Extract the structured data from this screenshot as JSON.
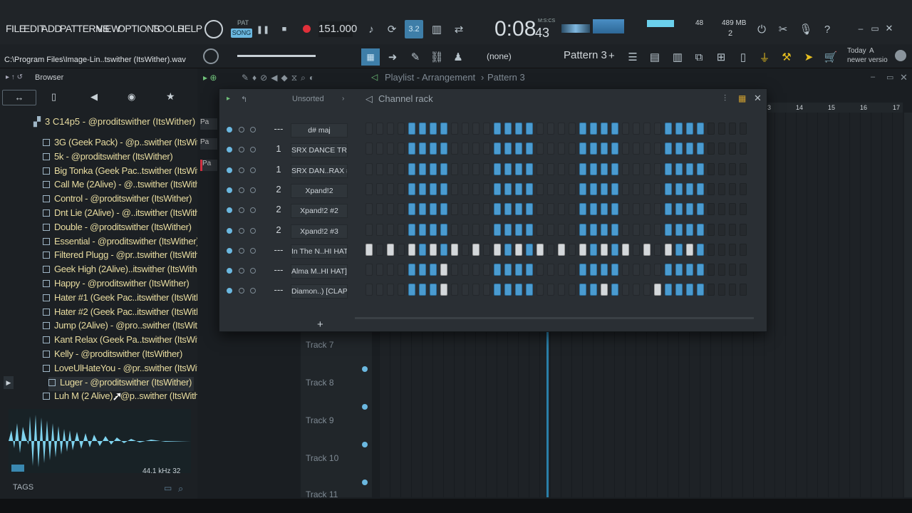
{
  "menu": {
    "items": [
      "FILE",
      "EDIT",
      "ADD",
      "PATTERNS",
      "VIEW",
      "OPTIONS",
      "TOOLS",
      "HELP"
    ]
  },
  "transport": {
    "pat_label": "PAT",
    "song_label": "SONG",
    "tempo": "151.000",
    "time": "0:08",
    "time_sub": "43",
    "time_unit": "M:S:CS"
  },
  "monitor": {
    "cpu_value": "48",
    "memory": "489 MB",
    "polyphony": "2"
  },
  "hint": {
    "date": "Today",
    "message_1": "A",
    "message_2": "newer versio"
  },
  "file_path": "C:\\Program Files\\Image-Lin..tswither (ItsWither).wav",
  "toolbar": {
    "none_label": "(none)",
    "pattern_label": "Pattern 3",
    "plus": "+"
  },
  "browser": {
    "title": "Browser",
    "folder": "3 C14p5 - @proditswither (ItsWither)",
    "items": [
      "3G (Geek Pack) - @p..swither (ItsWither)",
      "5k - @proditswither (ItsWither)",
      "Big Tonka (Geek Pac..tswither (ItsWither)",
      "Call Me (2Alive) - @..tswither (ItsWither)",
      "Control - @proditswither (ItsWither)",
      "Dnt Lie (2Alive) - @..itswither (ItsWither)",
      "Double - @proditswither (ItsWither)",
      "Essential - @proditswither (ItsWither)",
      "Filtered Plugg - @pr..tswither (ItsWither)",
      "Geek High (2Alive)..itswither (ItsWither)",
      "Happy - @proditswither (ItsWither)",
      "Hater #1 (Geek Pac..itswither (ItsWither)",
      "Hater #2 (Geek Pac..itswither (ItsWither)",
      "Jump (2Alive) - @pro..swither (ItsWither)",
      "Kant Relax (Geek Pa..tswither (ItsWither)",
      "Kelly - @proditswither (ItsWither)",
      "LoveUlHateYou - @pr..swither (ItsWither)",
      "Luger - @proditswither (ItsWither)",
      "Luh M (2 Alive) - @p..swither (ItsWither)"
    ],
    "sample_rate": "44.1 kHz 32",
    "tags_label": "TAGS"
  },
  "playlist": {
    "breadcrumb_1": "Playlist - Arrangement",
    "breadcrumb_2": "Pattern 3",
    "ruler": [
      "3",
      "14",
      "15",
      "16",
      "17"
    ],
    "tracks": [
      "Track 7",
      "Track 8",
      "Track 9",
      "Track 10",
      "Track 11"
    ],
    "pattern_tabs": [
      "Pa",
      "Pa",
      "Pa"
    ]
  },
  "channel_rack": {
    "title": "Channel rack",
    "filter": "Unsorted",
    "add_label": "+",
    "channels": [
      {
        "num": "---",
        "name": "d# maj"
      },
      {
        "num": "1",
        "name": "SRX DANCE TRAX"
      },
      {
        "num": "1",
        "name": "SRX DAN..RAX #2"
      },
      {
        "num": "2",
        "name": "Xpand!2"
      },
      {
        "num": "2",
        "name": "Xpand!2 #2"
      },
      {
        "num": "2",
        "name": "Xpand!2 #3"
      },
      {
        "num": "---",
        "name": "In The N..HI HAT]"
      },
      {
        "num": "---",
        "name": "Alma M..HI HAT]"
      },
      {
        "num": "---",
        "name": "Diamon..) [CLAP]"
      }
    ],
    "patterns": [
      "0000111100001111000011110000111100000000000",
      "0000111100001111000011110000111100000000000",
      "0000111100001111000011110000111100000000000",
      "0000111100001111000011110000111100000000000",
      "0000111100001111000011110000111100000000000",
      "0000111100001111000011110000111100000000000",
      "2020212120202121202021212020212100000000000",
      "0000111200001111000011110000111100000000000",
      "0000111200001111000011210002111100000000000"
    ]
  },
  "colors": {
    "accent": "#4a9bd0",
    "step_on": "#4a9bd0",
    "step_white": "#d4d8db",
    "browser_text": "#e8dca0",
    "waveform": "#7fd3ee"
  }
}
